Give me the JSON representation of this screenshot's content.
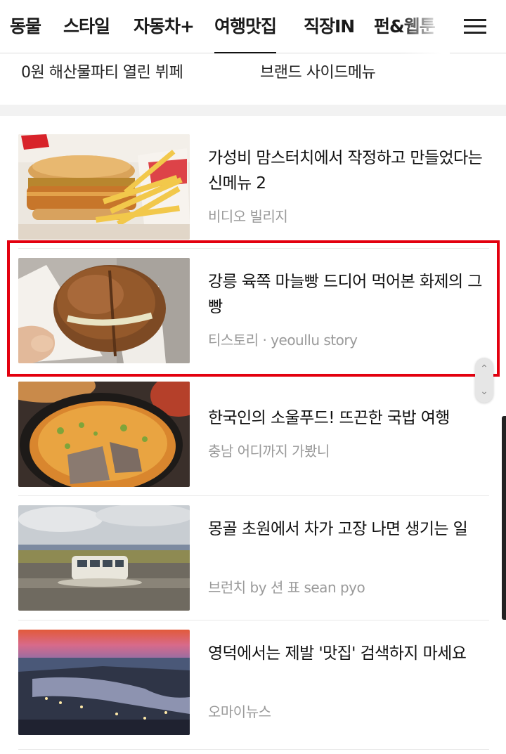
{
  "nav": {
    "tabs": [
      {
        "label": "동물"
      },
      {
        "label": "스타일"
      },
      {
        "label": "자동차+"
      },
      {
        "label": "여행맛집",
        "active": true
      },
      {
        "label": "직장IN"
      },
      {
        "label": "펀&웹툰"
      }
    ]
  },
  "prev_items": [
    {
      "line": "0원 해산물파티 열린 뷔페"
    },
    {
      "line": "브랜드 사이드메뉴"
    }
  ],
  "articles": [
    {
      "title": "가성비 맘스터치에서 작정하고 만들었다는 신메뉴 2",
      "source": "비디오 빌리지",
      "thumb_icon": "burger-fries-photo"
    },
    {
      "title": "강릉 육쪽 마늘빵 드디어 먹어본 화제의 그 빵",
      "source": "티스토리 · yeoullu story",
      "thumb_icon": "garlic-bread-photo",
      "highlighted": true
    },
    {
      "title": "한국인의 소울푸드! 뜨끈한 국밥 여행",
      "source": "충남 어디까지 가봤니",
      "thumb_icon": "gukbap-photo"
    },
    {
      "title": "몽골 초원에서 차가 고장 나면 생기는 일",
      "source": "브런치 by 션 표 sean pyo",
      "thumb_icon": "van-in-water-photo"
    },
    {
      "title": "영덕에서는 제발 '맛집' 검색하지 마세요",
      "source": "오마이뉴스",
      "thumb_icon": "coastal-sunset-photo"
    }
  ],
  "colors": {
    "highlight_border": "#e3000f",
    "source_text": "#9a9a9a"
  }
}
